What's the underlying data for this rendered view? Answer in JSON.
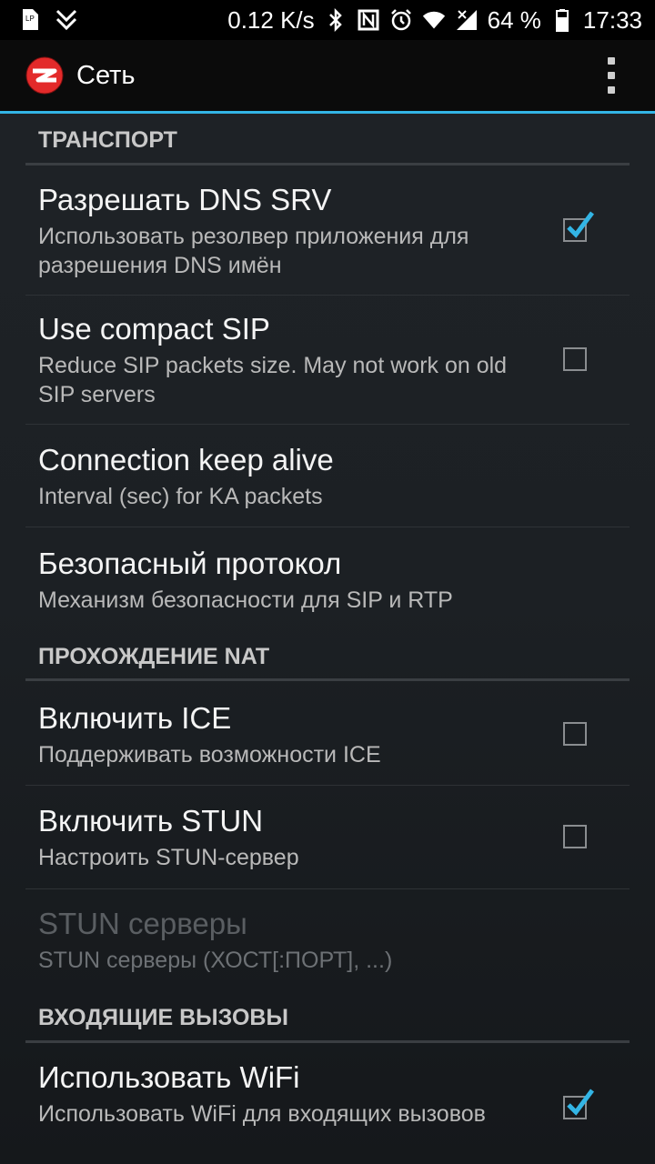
{
  "status_bar": {
    "speed": "0.12 K/s",
    "battery": "64 %",
    "time": "17:33",
    "icons": [
      "sim-icon",
      "download-icon",
      "bluetooth-icon",
      "nfc-icon",
      "alarm-icon",
      "wifi-icon",
      "signal-icon",
      "battery-icon"
    ]
  },
  "action_bar": {
    "title": "Сеть",
    "logo_icon": "zoiper-logo-icon",
    "menu_icon": "overflow-menu-icon"
  },
  "sections": {
    "transport": "ТРАНСПОРТ",
    "nat": "ПРОХОЖДЕНИЕ NAT",
    "incoming": "ВХОДЯЩИЕ ВЫЗОВЫ"
  },
  "items": {
    "dns_srv": {
      "title": "Разрешать DNS SRV",
      "summary": "Использовать резолвер приложения для разрешения DNS имён",
      "checked": true
    },
    "compact_sip": {
      "title": "Use compact SIP",
      "summary": "Reduce SIP packets size. May not work on old SIP servers",
      "checked": false
    },
    "keep_alive": {
      "title": "Connection keep alive",
      "summary": "Interval (sec) for KA packets"
    },
    "secure_protocol": {
      "title": "Безопасный протокол",
      "summary": "Механизм безопасности для SIP и RTP"
    },
    "ice": {
      "title": "Включить ICE",
      "summary": "Поддерживать возможности ICE",
      "checked": false
    },
    "stun": {
      "title": "Включить STUN",
      "summary": "Настроить STUN-сервер",
      "checked": false
    },
    "stun_servers": {
      "title": "STUN серверы",
      "summary": "STUN серверы (ХОСТ[:ПОРТ], ...)",
      "enabled": false
    },
    "use_wifi": {
      "title": "Использовать WiFi",
      "summary": "Использовать WiFi для входящих вызовов",
      "checked": true
    }
  },
  "colors": {
    "accent": "#33b5e5",
    "background": "#1c2024",
    "action_bar": "#0b0b0b"
  }
}
